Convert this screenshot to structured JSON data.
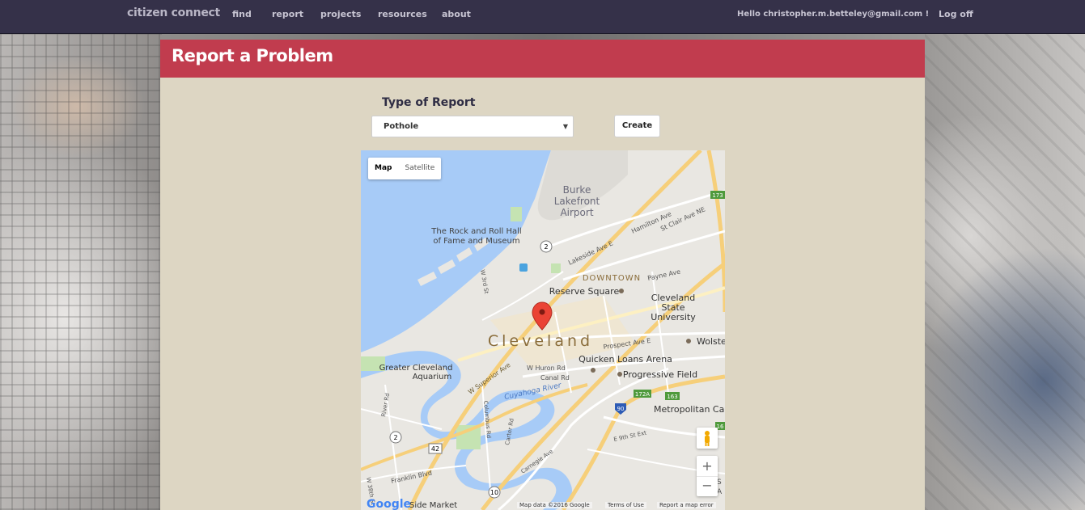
{
  "nav": {
    "brand": "citizen connect",
    "links": [
      "find",
      "report",
      "projects",
      "resources",
      "about"
    ],
    "greeting": "Hello christopher.m.betteley@gmail.com !",
    "logoff": "Log off"
  },
  "panel": {
    "title": "Report a Problem",
    "type_label": "Type of Report",
    "select_value": "Pothole",
    "create_label": "Create"
  },
  "map": {
    "type_map": "Map",
    "type_satellite": "Satellite",
    "zoom_in": "+",
    "zoom_out": "−",
    "labels": {
      "burke": "Burke",
      "lakefront": "Lakefront",
      "airport": "Airport",
      "rock1": "The Rock and Roll Hall",
      "rock2": "of Fame and Museum",
      "downtown": "DOWNTOWN",
      "reserve": "Reserve Square",
      "csu1": "Cleveland",
      "csu2": "State",
      "csu3": "University",
      "cleveland": "Cleveland",
      "wolste": "Wolste",
      "quicken": "Quicken Loans Arena",
      "progressive": "Progressive Field",
      "aquarium1": "Greater Cleveland",
      "aquarium2": "Aquarium",
      "metropolitan": "Metropolitan Ca",
      "cuyahoga": "Cuyahoga River",
      "superior": "W Superior Ave",
      "huron": "W Huron Rd",
      "canal": "Canal Rd",
      "prospect": "Prospect Ave E",
      "payne": "Payne Ave",
      "lakeside": "Lakeside Ave E",
      "hamilton": "Hamilton Ave",
      "stclair": "St Clair Ave NE",
      "w3rd": "W 3rd St",
      "columbus": "Columbus Rd",
      "carter": "Carter Rd",
      "carnegie": "Carnegie Ave",
      "e9th": "E 9th St Ext",
      "riverrd": "River Rd",
      "franklin": "Franklin Blvd",
      "w38th": "W 38th St",
      "sidemarket": "Side Market",
      "r2": "2",
      "r2b": "2",
      "r42": "42",
      "r10": "10",
      "r90": "90",
      "r172a": "172A",
      "r163": "163",
      "r173": "173",
      "r16": "16",
      "edgeA": "A",
      "edgeS": "S"
    },
    "footer": {
      "google": "Google",
      "data": "Map data ©2016 Google",
      "terms": "Terms of Use",
      "report": "Report a map error"
    }
  }
}
